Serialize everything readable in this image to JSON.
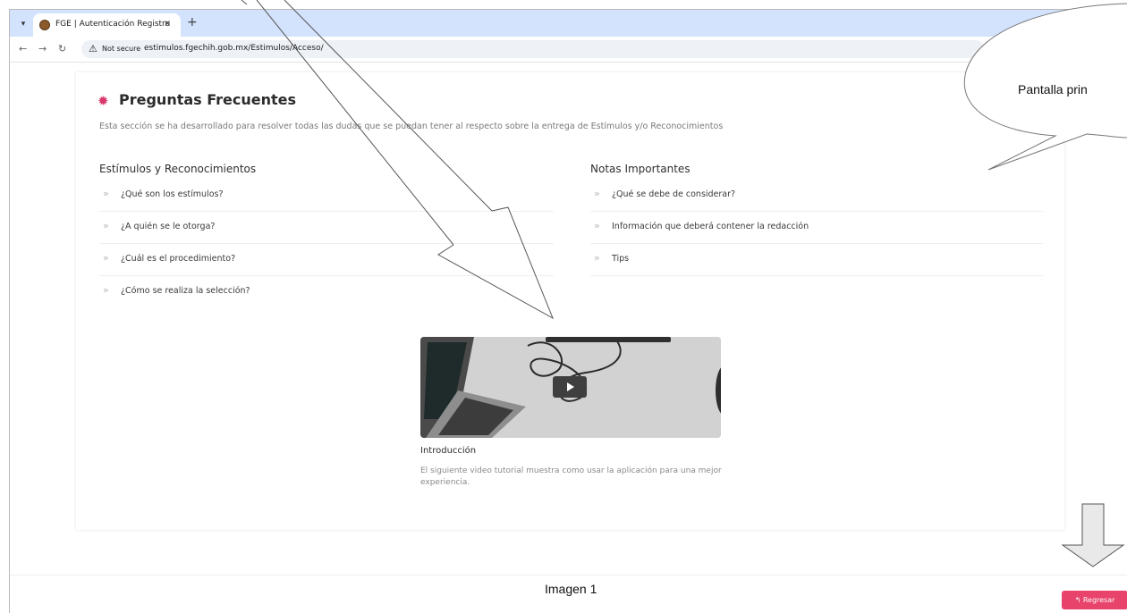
{
  "browser": {
    "tab_title": "FGE | Autenticación Registro",
    "tab_close": "×",
    "new_tab": "+",
    "not_secure_label": "Not secure",
    "url": "estimulos.fgechih.gob.mx/Estimulos/Acceso/"
  },
  "page": {
    "title": "Preguntas Frecuentes",
    "description": "Esta sección se ha desarrollado para resolver todas las dudas que se puedan tener al respecto sobre la entrega de Estímulos y/o Reconocimientos"
  },
  "left_column": {
    "title": "Estímulos y Reconocimientos",
    "items": [
      "¿Qué son los estímulos?",
      "¿A quién se le otorga?",
      "¿Cuál es el procedimiento?",
      "¿Cómo se realiza la selección?"
    ]
  },
  "right_column": {
    "title": "Notas Importantes",
    "items": [
      "¿Qué se debe de considerar?",
      "Información que deberá contener la redacción",
      "Tips"
    ]
  },
  "video": {
    "title": "Introducción",
    "description": "El siguiente video tutorial muestra como usar la aplicación para una mejor experiencia."
  },
  "footer": {
    "caption": "Imagen 1",
    "back_label": "↰ Regresar"
  },
  "annotation": {
    "bubble_text": "Pantalla prin"
  },
  "colors": {
    "accent": "#e8436a",
    "tab_strip": "#d3e3fd"
  }
}
